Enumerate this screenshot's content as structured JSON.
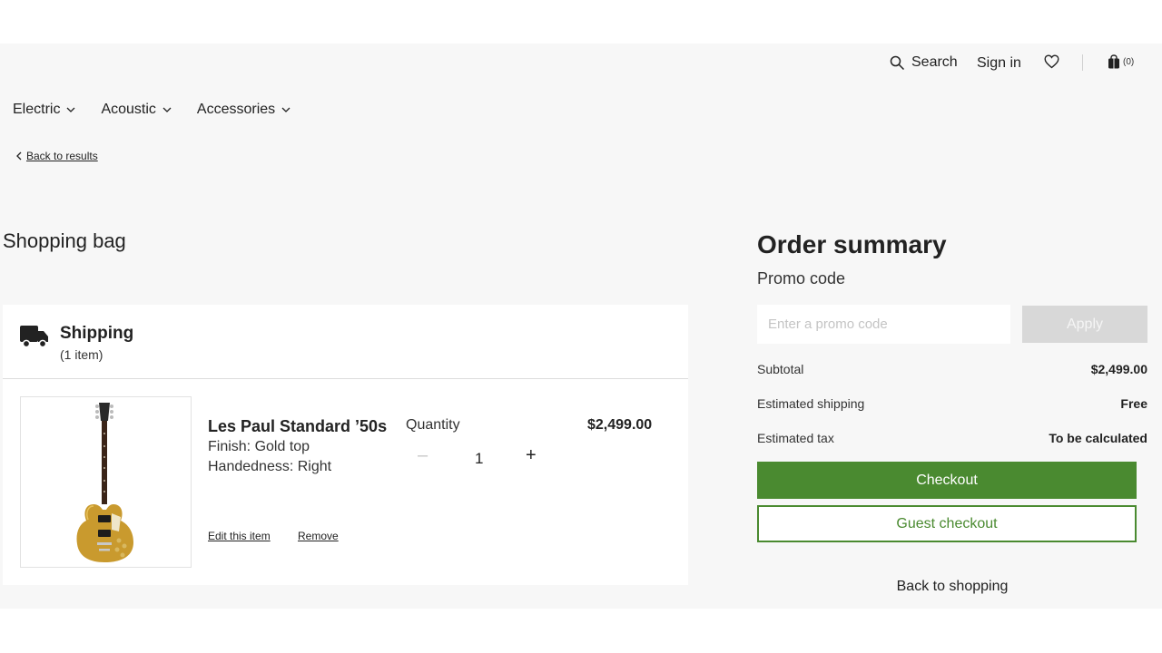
{
  "header": {
    "search_label": "Search",
    "signin_label": "Sign in",
    "bag_count": "(0)",
    "icons": {
      "search": "search-icon",
      "wishlist": "heart-icon",
      "bag": "shopping-bag-icon"
    }
  },
  "nav": {
    "items": [
      {
        "label": "Electric"
      },
      {
        "label": "Acoustic"
      },
      {
        "label": "Accessories"
      }
    ]
  },
  "breadcrumb": {
    "back_label": "Back to results"
  },
  "page": {
    "title": "Shopping bag"
  },
  "shipping": {
    "title": "Shipping",
    "count": "(1 item)",
    "icon": "truck-icon"
  },
  "item": {
    "name": "Les Paul Standard ’50s",
    "finish": "Finish: Gold top",
    "handedness": "Handedness: Right",
    "quantity_label": "Quantity",
    "quantity": "1",
    "price": "$2,499.00",
    "edit_label": "Edit this item",
    "remove_label": "Remove"
  },
  "summary": {
    "title": "Order summary",
    "promo_label": "Promo code",
    "promo_placeholder": "Enter a promo code",
    "apply_label": "Apply",
    "rows": [
      {
        "label": "Subtotal",
        "value": "$2,499.00"
      },
      {
        "label": "Estimated shipping",
        "value": "Free"
      },
      {
        "label": "Estimated tax",
        "value": "To be calculated"
      }
    ],
    "checkout_label": "Checkout",
    "guest_checkout_label": "Guest checkout",
    "back_to_shopping_label": "Back to shopping"
  },
  "colors": {
    "brand_green": "#4a8a30",
    "apply_disabled": "#d8d8d8",
    "background": "#f7f7f7"
  }
}
